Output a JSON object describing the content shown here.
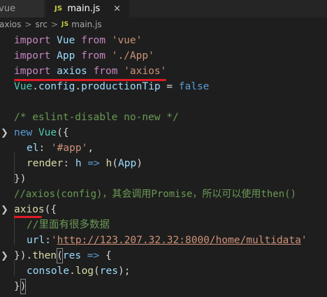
{
  "tabs": [
    {
      "label": ".vue",
      "active": false
    },
    {
      "label": "main.js",
      "active": true,
      "icon": "JS",
      "close": "×"
    }
  ],
  "breadcrumb": {
    "segments": [
      "axios",
      "src",
      "main.js"
    ],
    "separator": ">",
    "file_icon": "JS"
  },
  "code": {
    "l1": {
      "kw": "import",
      "id": "Vue",
      "from": "from",
      "str": "'vue'"
    },
    "l2": {
      "kw": "import",
      "id": "App",
      "from": "from",
      "str": "'./App'"
    },
    "l3": {
      "kw": "import",
      "id": "axios",
      "from": "from",
      "str": "'axios'"
    },
    "l4": {
      "obj": "Vue",
      "prop1": "config",
      "prop2": "productionTip",
      "op": " = ",
      "val": "false"
    },
    "l6": {
      "comment": "/* eslint-disable no-new */"
    },
    "l7": {
      "kw": "new",
      "cls": "Vue",
      "pun": "({"
    },
    "l8": {
      "key": "el",
      "pun": ": ",
      "str": "'#app'",
      "end": ","
    },
    "l9": {
      "key": "render",
      "pun": ": ",
      "arg": "h",
      "arrow": " => ",
      "fn": "h",
      "open": "(",
      "ref": "App",
      "close": ")"
    },
    "l10": {
      "text": "})"
    },
    "l11": {
      "comment": "//axios(config)，其会调用Promise，所以可以使用then()"
    },
    "l12": {
      "fn": "axios",
      "pun": "({"
    },
    "l13": {
      "comment": "//里面有很多数据"
    },
    "l14": {
      "key": "url",
      "pun": ":",
      "str_q1": "'",
      "url": "http://123.207.32.32:8000/home/multidata",
      "str_q2": "'"
    },
    "l15": {
      "open": "}).",
      "fn": "then",
      "paren": "(",
      "arg": "res",
      "arrow": " => ",
      "brace": "{"
    },
    "l16": {
      "obj": "console",
      "dot": ".",
      "fn": "log",
      "open": "(",
      "arg": "res",
      "close": ");"
    },
    "l17": {
      "brace": "}",
      "paren": ")"
    }
  },
  "colors": {
    "keyword": "#c586c0",
    "string": "#ce9178",
    "variable": "#9cdcfe",
    "function": "#dcdcaa",
    "class": "#4ec9b0",
    "comment": "#6a9955",
    "annotation": "#e01b24",
    "background": "#1e1e1e"
  }
}
